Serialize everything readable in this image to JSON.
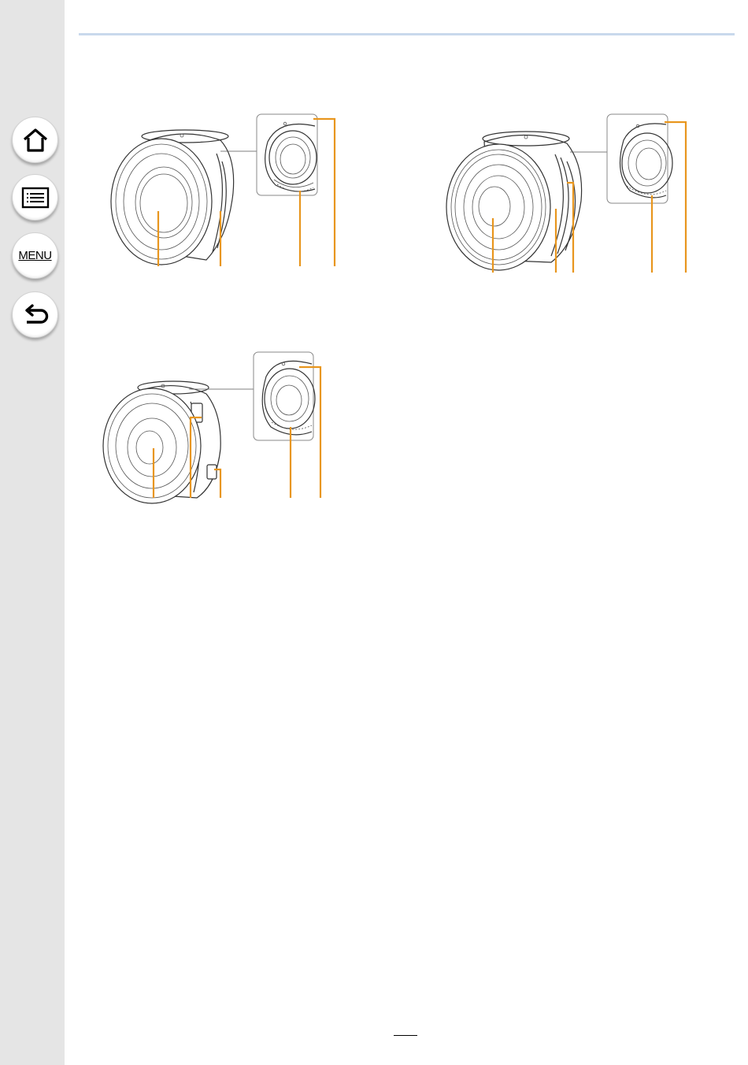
{
  "nav": {
    "home_icon": "home-icon",
    "toc_icon": "list-icon",
    "menu_label": "MENU",
    "back_icon": "back-arrow-icon"
  },
  "page": {
    "number": ""
  },
  "colors": {
    "callout": "#e8961e",
    "nav_background": "#e5e5e5",
    "rule": "#c9d9ec"
  }
}
